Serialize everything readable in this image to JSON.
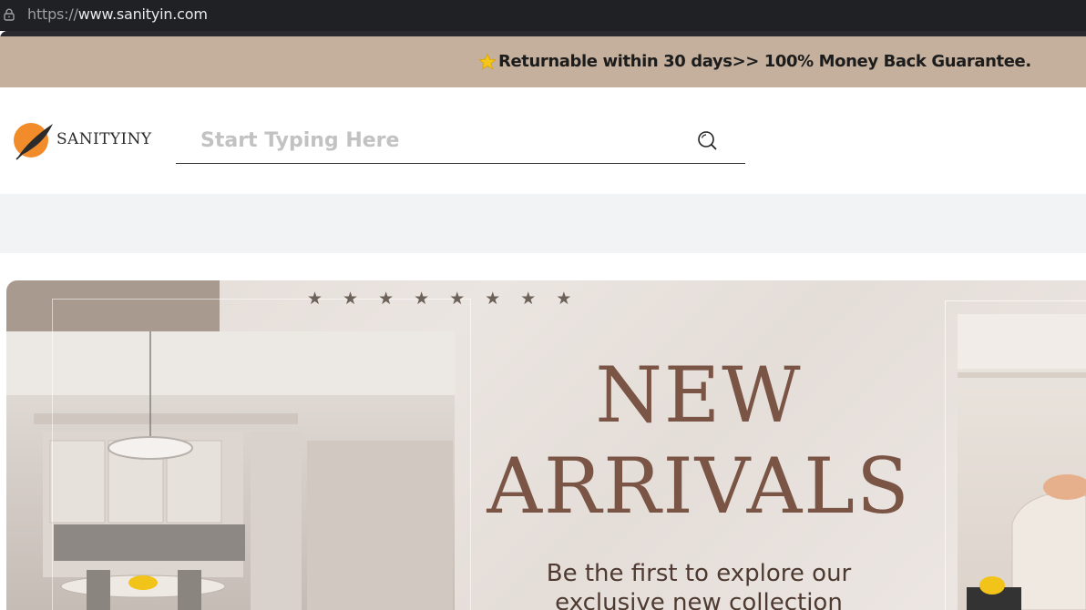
{
  "browser": {
    "url_prefix": "https://",
    "url_domain": "www.sanityin.com"
  },
  "announcement": {
    "icon": "star-icon",
    "text": "Returnable within 30 days>> 100% Money Back Guarantee."
  },
  "header": {
    "logo_text": "SANITYINY",
    "search_placeholder": "Start Typing Here",
    "search_icon": "search-icon"
  },
  "hero": {
    "rating_stars": 8,
    "title_line1": "NEW",
    "title_line2": "ARRIVALS",
    "subtitle_line1": "Be the first to explore our",
    "subtitle_line2": "exclusive new collection"
  },
  "colors": {
    "announcement_bg": "#c4b09c",
    "title_color": "#7a5444",
    "logo_orange": "#f28c2a"
  }
}
